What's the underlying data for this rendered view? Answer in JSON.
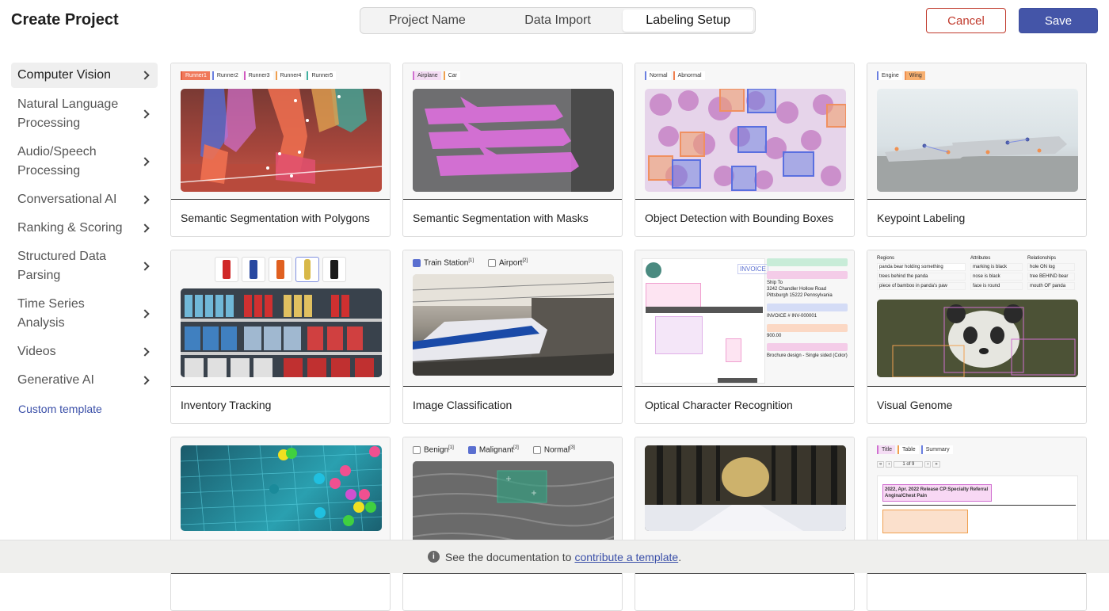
{
  "header": {
    "title": "Create Project",
    "tabs": [
      "Project Name",
      "Data Import",
      "Labeling Setup"
    ],
    "active_tab": "Labeling Setup",
    "cancel_label": "Cancel",
    "save_label": "Save"
  },
  "sidebar": {
    "items": [
      {
        "label": "Computer Vision"
      },
      {
        "label": "Natural Language Processing"
      },
      {
        "label": "Audio/Speech Processing"
      },
      {
        "label": "Conversational AI"
      },
      {
        "label": "Ranking & Scoring"
      },
      {
        "label": "Structured Data Parsing"
      },
      {
        "label": "Time Series Analysis"
      },
      {
        "label": "Videos"
      },
      {
        "label": "Generative AI"
      }
    ],
    "custom_template_label": "Custom template"
  },
  "cards": [
    {
      "name": "Semantic Segmentation with Polygons",
      "chips": [
        "Runner1",
        "Runner2",
        "Runner3",
        "Runner4",
        "Runner5"
      ]
    },
    {
      "name": "Semantic Segmentation with Masks",
      "chips": [
        "Airplane",
        "Car"
      ]
    },
    {
      "name": "Object Detection with Bounding Boxes",
      "chips": [
        "Normal",
        "Abnormal"
      ]
    },
    {
      "name": "Keypoint Labeling",
      "chips": [
        "Engine",
        "Wing"
      ]
    },
    {
      "name": "Inventory Tracking"
    },
    {
      "name": "Image Classification",
      "checks": [
        "Train Station",
        "Airport"
      ]
    },
    {
      "name": "Optical Character Recognition",
      "ocr": {
        "brand": "INVOICE",
        "ship_to": "Ship To",
        "address": "3242 Chandler Hollow Road Pittsburgh 15222 Pennsylvania",
        "invoice": "INVOICE # INV-000001",
        "price": "900.00",
        "desc": "Brochure design - Single sided (Color)"
      }
    },
    {
      "name": "Visual Genome",
      "vg": {
        "regions": "Regions",
        "attributes": "Attributes",
        "relationships": "Relationships",
        "r1": "panda bear holding something",
        "r2": "trees behind the panda",
        "r3": "piece of bamboo in panda's paw",
        "a1": "marking is black",
        "a2": "nose is black",
        "a3": "face is round",
        "l1": "hole ON log",
        "l2": "tree BEHIND bear",
        "l3": "mouth OF panda"
      }
    },
    {
      "name": ""
    },
    {
      "name": "",
      "checks": [
        "Benign",
        "Malignant",
        "Normal"
      ]
    },
    {
      "name": ""
    },
    {
      "name": "",
      "chips": [
        "Title",
        "Table",
        "Summary"
      ],
      "doc": {
        "pager": "1 of 9",
        "heading": "2022, Apr. 2022 Release CP:Specialty Referral Angina/Chest Pain"
      }
    }
  ],
  "footer": {
    "text": "See the documentation to",
    "link": "contribute a template",
    "end": "."
  },
  "colors": {
    "accent": "#4455a8",
    "danger": "#c0392b"
  }
}
